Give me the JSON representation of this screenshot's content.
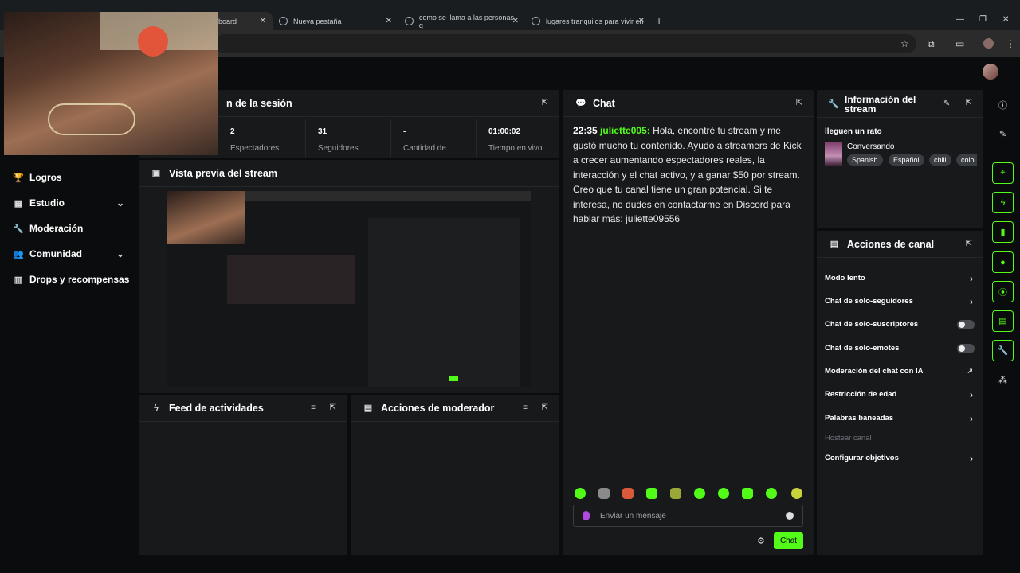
{
  "browser": {
    "tabs": [
      {
        "label": "board"
      },
      {
        "label": "Nueva pestaña"
      },
      {
        "label": "como se llama a las personas q"
      },
      {
        "label": "lugares tranquilos para vivir en"
      }
    ]
  },
  "sidebar": {
    "items": [
      {
        "label": "Logros",
        "icon": "trophy-icon"
      },
      {
        "label": "Estudio",
        "icon": "studio-icon",
        "expandable": true
      },
      {
        "label": "Moderación",
        "icon": "wrench-icon"
      },
      {
        "label": "Comunidad",
        "icon": "community-icon",
        "expandable": true
      },
      {
        "label": "Drops y recompensas",
        "icon": "chart-icon"
      }
    ]
  },
  "session": {
    "title": "n de la sesión",
    "stats": [
      {
        "value": "2",
        "label": "Espectadores"
      },
      {
        "value": "31",
        "label": "Seguidores"
      },
      {
        "value": "-",
        "label": "Cantidad de"
      },
      {
        "value": "01:00:02",
        "label": "Tiempo en vivo"
      }
    ]
  },
  "preview": {
    "title": "Vista previa del stream"
  },
  "feed": {
    "title": "Feed de actividades"
  },
  "modactions": {
    "title": "Acciones de moderador"
  },
  "chat": {
    "title": "Chat",
    "message": {
      "time": "22:35",
      "user": "juliette005:",
      "text": " Hola, encontré tu stream y me gustó mucho tu contenido. Ayudo a streamers de Kick a crecer aumentando espectadores reales, la interacción y el chat activo, y a ganar $50 por stream. Creo que tu canal tiene un gran potencial. Si te interesa, no dudes en contactarme en Discord para hablar más: juliette09556"
    },
    "placeholder": "Enviar un mensaje",
    "send": "Chat"
  },
  "info": {
    "title_line1": "Información del",
    "title_line2": "stream",
    "subtitle": "lleguen un rato",
    "category": "Conversando",
    "tags": [
      "Spanish",
      "Español",
      "chill",
      "colo"
    ]
  },
  "channel": {
    "title": "Acciones de canal",
    "actions": [
      {
        "label": "Modo lento"
      },
      {
        "label": "Chat de solo-seguidores"
      },
      {
        "label": "Chat de solo-suscriptores"
      },
      {
        "label": "Chat de solo-emotes"
      },
      {
        "label": "Moderación del chat con IA"
      },
      {
        "label": "Restricción de edad"
      },
      {
        "label": "Palabras baneadas"
      },
      {
        "label": "Hostear canal"
      },
      {
        "label": "Configurar objetivos"
      }
    ]
  },
  "colors": {
    "accent": "#53fc18",
    "panel": "#17191b",
    "background": "#0b0c0d"
  }
}
